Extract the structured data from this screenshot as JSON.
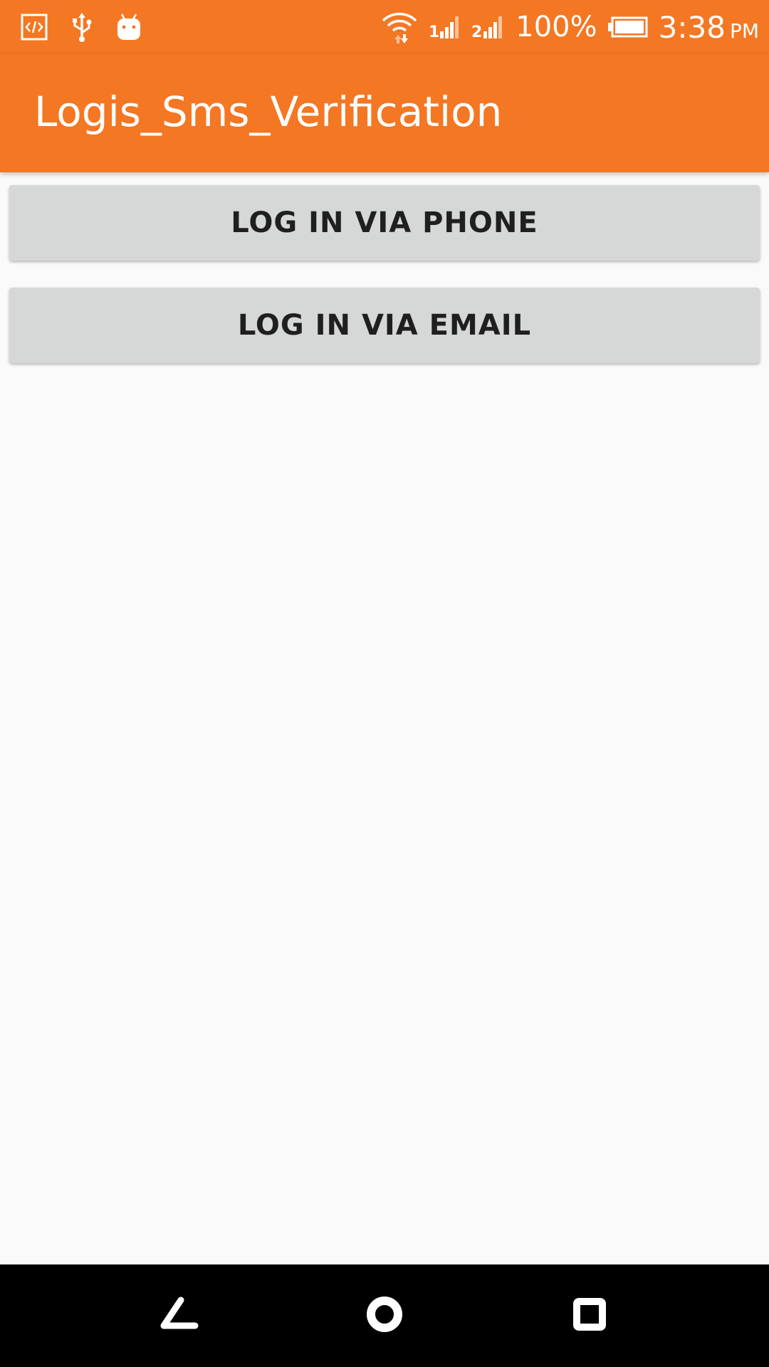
{
  "status_bar": {
    "left_icons": [
      "dev-code-icon",
      "usb-icon",
      "android-icon"
    ],
    "right_icons": [
      "wifi-icon",
      "signal-sim1-icon",
      "signal-sim2-icon",
      "battery-icon"
    ],
    "sim1_label": "1",
    "sim2_label": "2",
    "battery_percent": "100%",
    "time": "3:38",
    "ampm": "PM"
  },
  "app_bar": {
    "title": "Logis_Sms_Verification"
  },
  "main": {
    "phone_button_label": "LOG IN VIA PHONE",
    "email_button_label": "LOG IN VIA EMAIL"
  },
  "nav_bar": {
    "icons": [
      "back-icon",
      "home-icon",
      "recents-icon"
    ]
  },
  "colors": {
    "primary": "#f47723",
    "button_bg": "#d6d7d7",
    "background": "#fafafa",
    "nav_bg": "#000000"
  }
}
